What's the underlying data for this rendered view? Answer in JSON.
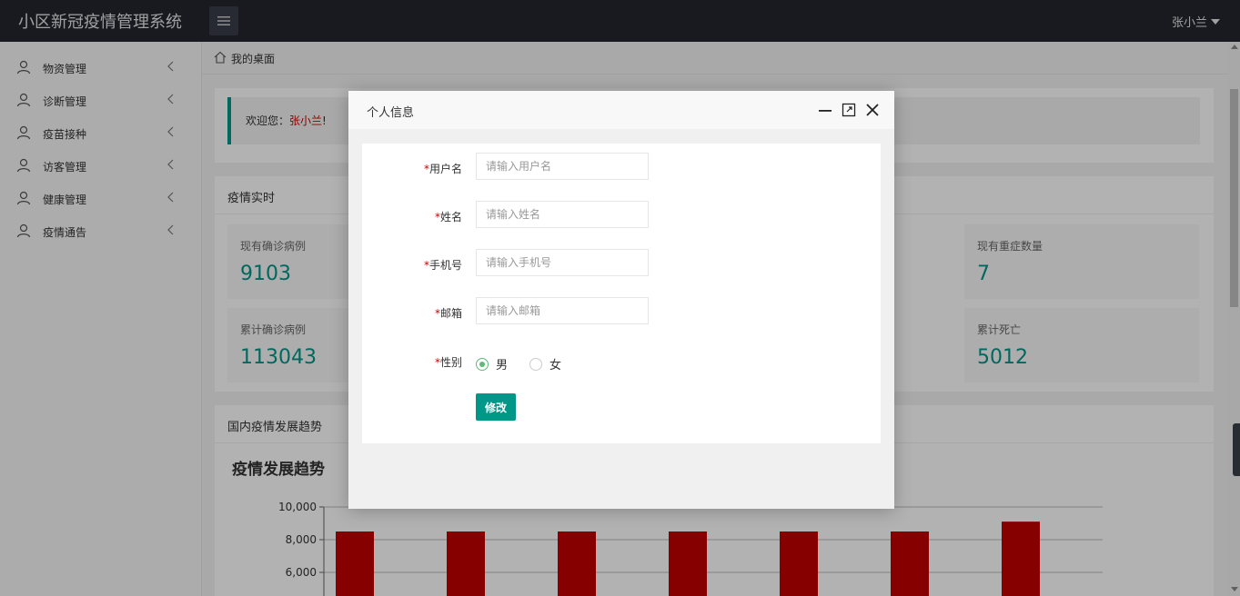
{
  "app": {
    "title": "小区新冠疫情管理系统",
    "user": "张小兰"
  },
  "sidebar": {
    "items": [
      {
        "label": "物资管理"
      },
      {
        "label": "诊断管理"
      },
      {
        "label": "疫苗接种"
      },
      {
        "label": "访客管理"
      },
      {
        "label": "健康管理"
      },
      {
        "label": "疫情通告"
      }
    ]
  },
  "breadcrumb": {
    "label": "我的桌面"
  },
  "welcome": {
    "prefix": "欢迎您：",
    "name": "张小兰",
    "suffix": "!"
  },
  "realtime": {
    "title": "疫情实时",
    "stats": [
      {
        "label": "现有确诊病例",
        "value": "9103"
      },
      {
        "label": "现有重症数量",
        "value": "7"
      },
      {
        "label": "累计确诊病例",
        "value": "113043"
      },
      {
        "label": "累计死亡",
        "value": "5012"
      }
    ]
  },
  "trend": {
    "title": "国内疫情发展趋势",
    "chart_data": {
      "type": "bar",
      "title": "疫情发展趋势",
      "values": [
        8500,
        8500,
        8500,
        8500,
        8500,
        8500,
        9103
      ],
      "ylim": [
        0,
        10000
      ],
      "yticks": [
        "10,000",
        "8,000",
        "6,000"
      ],
      "grid": true,
      "color": "#c00000"
    }
  },
  "modal": {
    "title": "个人信息",
    "fields": [
      {
        "label": "用户名",
        "placeholder": "请输入用户名"
      },
      {
        "label": "姓名",
        "placeholder": "请输入姓名"
      },
      {
        "label": "手机号",
        "placeholder": "请输入手机号"
      },
      {
        "label": "邮箱",
        "placeholder": "请输入邮箱"
      }
    ],
    "gender": {
      "label": "性别",
      "options": [
        "男",
        "女"
      ],
      "selected": "男"
    },
    "required_mark": "*",
    "submit_label": "修改"
  },
  "colors": {
    "accent": "#009688",
    "header": "#23262e",
    "bar": "#c00000",
    "radio": "#5fb878"
  }
}
